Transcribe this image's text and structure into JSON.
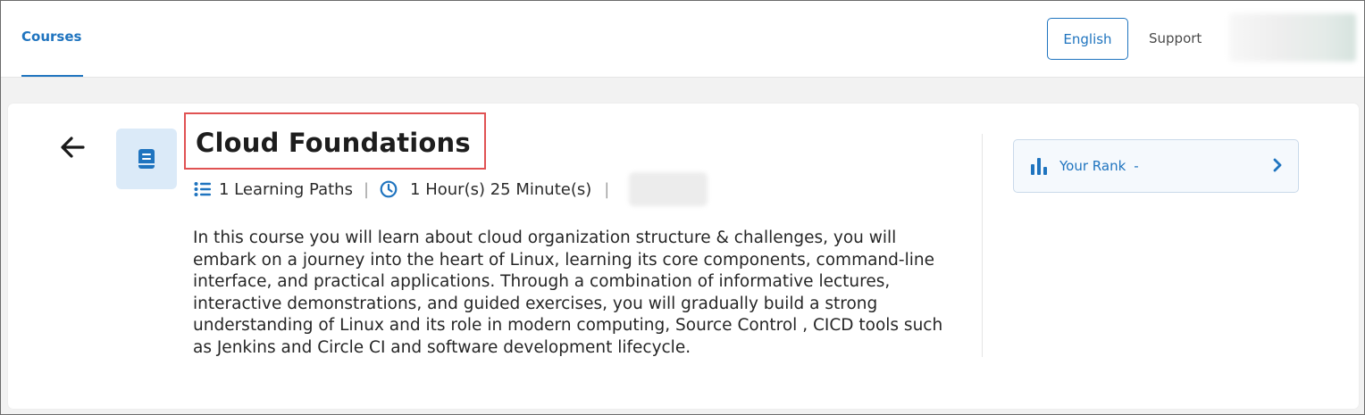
{
  "nav": {
    "courses_tab": "Courses",
    "language_button": "English",
    "support_link": "Support"
  },
  "course": {
    "title": "Cloud Foundations",
    "learning_paths": "1 Learning Paths",
    "duration": "1 Hour(s) 25 Minute(s)",
    "separator": "|",
    "description": "In this course you will learn about cloud organization structure & challenges, you will embark on a journey into the heart of Linux, learning its core components, command-line interface, and practical applications. Through a combination of informative lectures, interactive demonstrations, and guided exercises, you will gradually build a strong understanding of Linux and its role in modern computing, Source Control , CICD tools such as Jenkins and Circle CI and software development lifecycle."
  },
  "rank": {
    "label": "Your Rank",
    "value": "-"
  },
  "icons": {
    "back": "arrow-left-icon",
    "course": "book-icon",
    "list": "list-icon",
    "clock": "clock-icon",
    "rank": "bar-chart-icon",
    "chevron": "chevron-right-icon"
  },
  "colors": {
    "accent": "#1f74bf",
    "highlight_border": "#e05253",
    "icon_bg": "#dbeaf8"
  }
}
